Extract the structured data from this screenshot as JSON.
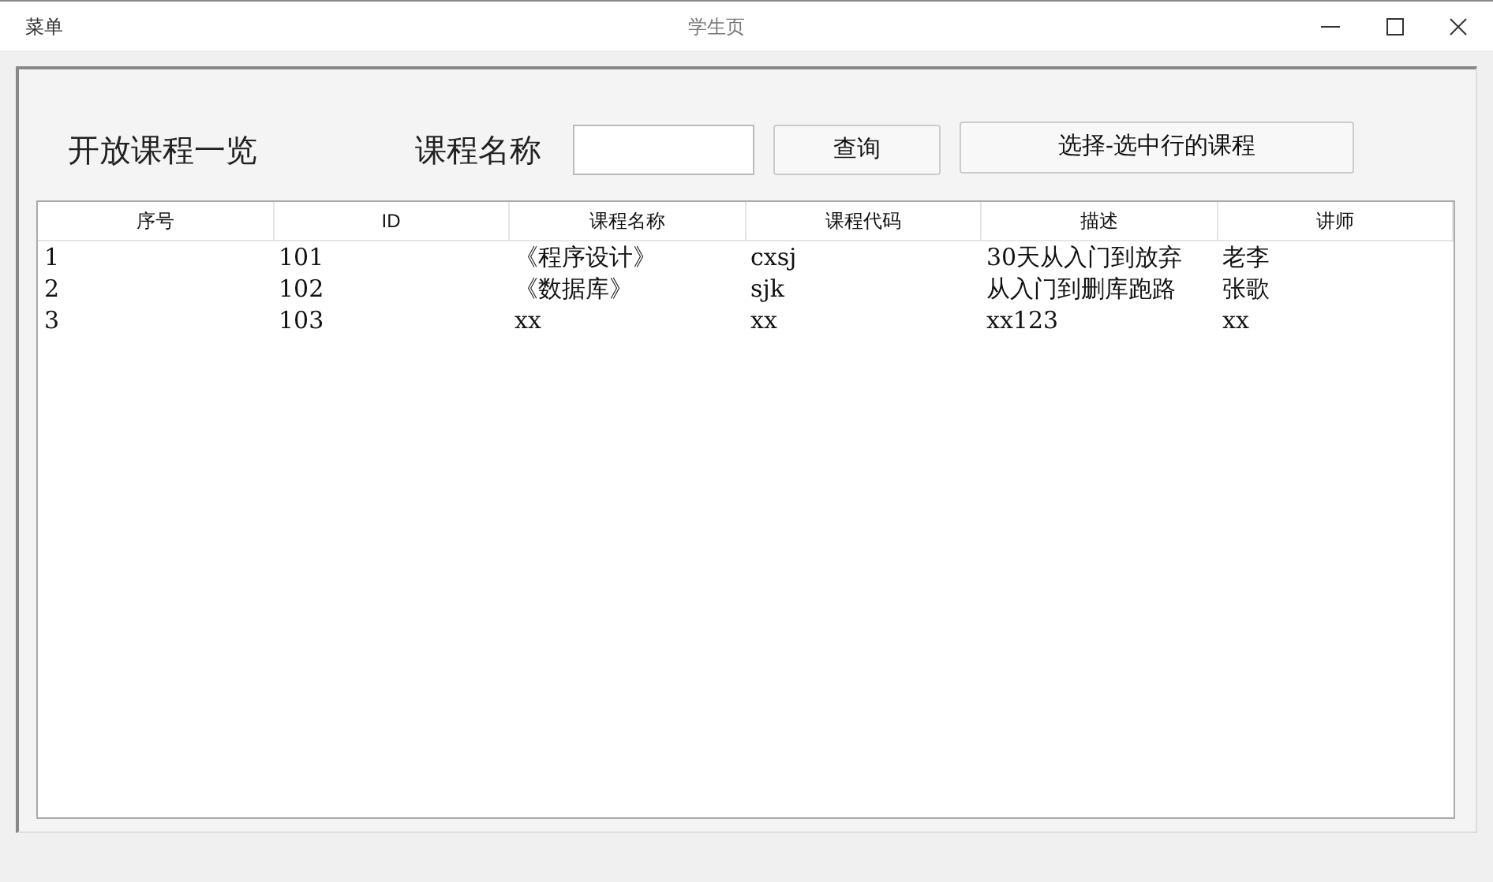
{
  "window": {
    "menu": "菜单",
    "title": "学生页"
  },
  "heading": "开放课程一览",
  "search": {
    "label": "课程名称"
  },
  "buttons": [
    "查询",
    "选择-选中行的课程"
  ],
  "table": {
    "columns": [
      "序号",
      "ID",
      "课程名称",
      "课程代码",
      "描述",
      "讲师"
    ],
    "rows": [
      [
        "1",
        "101",
        "《程序设计》",
        "cxsj",
        "30天从入门到放弃",
        "老李"
      ],
      [
        "2",
        "102",
        "《数据库》",
        "sjk",
        "从入门到删库跑路",
        "张歌"
      ],
      [
        "3",
        "103",
        "xx",
        "xx",
        "xx123",
        "xx"
      ]
    ]
  }
}
